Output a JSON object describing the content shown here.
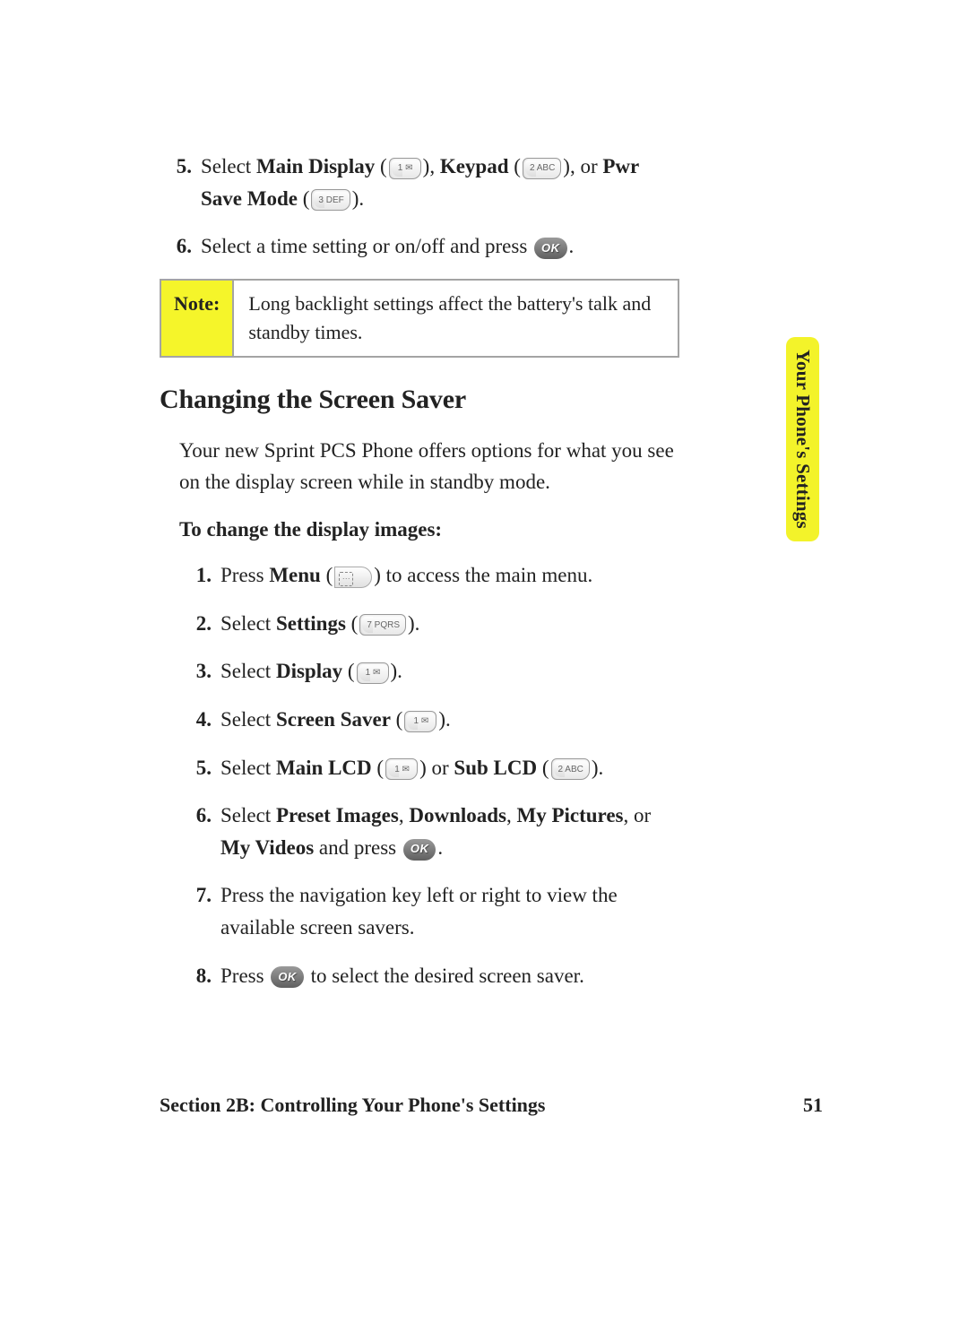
{
  "topList": [
    {
      "num": "5.",
      "parts": [
        {
          "t": "Select "
        },
        {
          "t": "Main Display",
          "b": true
        },
        {
          "t": " ("
        },
        {
          "key": "1 ✉"
        },
        {
          "t": "), "
        },
        {
          "t": "Keypad",
          "b": true
        },
        {
          "t": " ("
        },
        {
          "key": "2 ABC"
        },
        {
          "t": "), or "
        },
        {
          "t": "Pwr Save Mode",
          "b": true
        },
        {
          "t": " ("
        },
        {
          "key": "3 DEF"
        },
        {
          "t": ")."
        }
      ]
    },
    {
      "num": "6.",
      "parts": [
        {
          "t": "Select a time setting or on/off and press "
        },
        {
          "ok": true
        },
        {
          "t": "."
        }
      ]
    }
  ],
  "note": {
    "label": "Note:",
    "text": "Long backlight settings affect the battery's talk and standby times."
  },
  "heading": "Changing the Screen Saver",
  "intro": "Your new Sprint PCS Phone offers options for what you see on the display screen while in standby mode.",
  "subheading": "To change the display images:",
  "steps": [
    {
      "num": "1.",
      "parts": [
        {
          "t": "Press "
        },
        {
          "t": "Menu",
          "b": true
        },
        {
          "t": " ("
        },
        {
          "menu": true
        },
        {
          "t": ") to access the main menu."
        }
      ]
    },
    {
      "num": "2.",
      "parts": [
        {
          "t": "Select "
        },
        {
          "t": "Settings",
          "b": true
        },
        {
          "t": " ("
        },
        {
          "key": "7 PQRS"
        },
        {
          "t": ")."
        }
      ]
    },
    {
      "num": "3.",
      "parts": [
        {
          "t": "Select "
        },
        {
          "t": "Display",
          "b": true
        },
        {
          "t": " ("
        },
        {
          "key": "1 ✉"
        },
        {
          "t": ")."
        }
      ]
    },
    {
      "num": "4.",
      "parts": [
        {
          "t": "Select "
        },
        {
          "t": "Screen Saver",
          "b": true
        },
        {
          "t": " ("
        },
        {
          "key": "1 ✉"
        },
        {
          "t": ")."
        }
      ]
    },
    {
      "num": "5.",
      "parts": [
        {
          "t": "Select "
        },
        {
          "t": "Main LCD",
          "b": true
        },
        {
          "t": " ("
        },
        {
          "key": "1 ✉"
        },
        {
          "t": ") or "
        },
        {
          "t": "Sub LCD",
          "b": true
        },
        {
          "t": " ("
        },
        {
          "key": "2 ABC"
        },
        {
          "t": ")."
        }
      ]
    },
    {
      "num": "6.",
      "parts": [
        {
          "t": "Select "
        },
        {
          "t": "Preset Images",
          "b": true
        },
        {
          "t": ", "
        },
        {
          "t": "Downloads",
          "b": true
        },
        {
          "t": ", "
        },
        {
          "t": "My Pictures",
          "b": true
        },
        {
          "t": ", or "
        },
        {
          "t": "My Videos",
          "b": true
        },
        {
          "t": " and press "
        },
        {
          "ok": true
        },
        {
          "t": "."
        }
      ]
    },
    {
      "num": "7.",
      "parts": [
        {
          "t": "Press the navigation key left or right to view the available screen savers."
        }
      ]
    },
    {
      "num": "8.",
      "parts": [
        {
          "t": "Press "
        },
        {
          "ok": true
        },
        {
          "t": " to select the desired screen saver."
        }
      ]
    }
  ],
  "sideTab": "Your Phone's Settings",
  "footer": {
    "section": "Section 2B: Controlling Your Phone's Settings",
    "page": "51"
  },
  "okLabel": "OK"
}
